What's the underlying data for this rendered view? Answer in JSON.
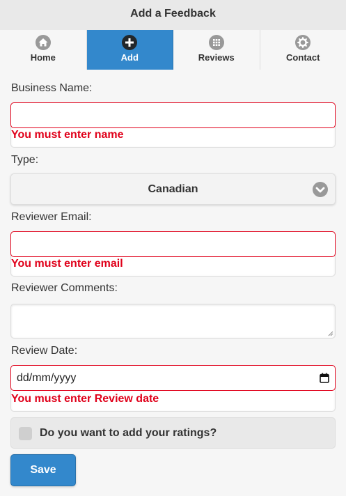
{
  "header": {
    "title": "Add a Feedback"
  },
  "nav": {
    "items": [
      {
        "label": "Home",
        "icon": "home-icon"
      },
      {
        "label": "Add",
        "icon": "plus-icon"
      },
      {
        "label": "Reviews",
        "icon": "grid-icon"
      },
      {
        "label": "Contact",
        "icon": "gear-icon"
      }
    ],
    "active_index": 1
  },
  "form": {
    "business_name": {
      "label": "Business Name:",
      "value": "",
      "error": "You must enter name"
    },
    "type": {
      "label": "Type:",
      "selected": "Canadian"
    },
    "reviewer_email": {
      "label": "Reviewer Email:",
      "value": "",
      "error": "You must enter email"
    },
    "reviewer_comments": {
      "label": "Reviewer Comments:",
      "value": ""
    },
    "review_date": {
      "label": "Review Date:",
      "placeholder": "dd/mm/yyyy",
      "error": "You must enter Review date"
    },
    "ratings_checkbox": {
      "label": "Do you want to add your ratings?",
      "checked": false
    },
    "save_label": "Save"
  },
  "colors": {
    "accent": "#3388cc",
    "error": "#e0001a",
    "header_bg": "#e9e9e9"
  }
}
